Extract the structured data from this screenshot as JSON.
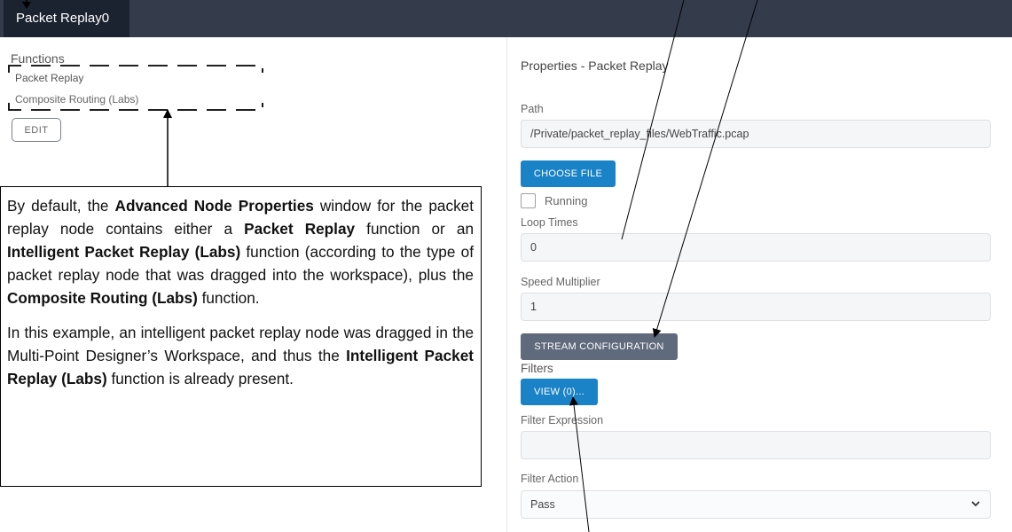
{
  "tab": {
    "label": "Packet Replay0"
  },
  "functions": {
    "title": "Functions",
    "items": [
      {
        "label": "Packet Replay"
      },
      {
        "label": "Composite Routing (Labs)"
      }
    ],
    "edit_label": "EDIT"
  },
  "callout": {
    "p1": [
      {
        "t": "By default, the ",
        "b": false
      },
      {
        "t": "Advanced Node Properties",
        "b": true
      },
      {
        "t": " window for the packet replay node contains either a ",
        "b": false
      },
      {
        "t": "Packet Replay",
        "b": true
      },
      {
        "t": " function or an ",
        "b": false
      },
      {
        "t": "Intelligent Packet Replay (Labs)",
        "b": true
      },
      {
        "t": " function (according to the type of packet replay node that was dragged into the workspace), plus the ",
        "b": false
      },
      {
        "t": "Composite Routing (Labs)",
        "b": true
      },
      {
        "t": " function.",
        "b": false
      }
    ],
    "p2": [
      {
        "t": "In this example, an intelligent packet replay node was dragged in the Multi-Point Designer’s Workspace, and thus the ",
        "b": false
      },
      {
        "t": "Intelligent Packet Replay (Labs)",
        "b": true
      },
      {
        "t": " function is already present.",
        "b": false
      }
    ]
  },
  "properties": {
    "title": "Properties  - Packet Replay",
    "path_label": "Path",
    "path_value": "/Private/packet_replay_files/WebTraffic.pcap",
    "choose_file_label": "CHOOSE FILE",
    "running_label": "Running",
    "loop_times_label": "Loop Times",
    "loop_times_value": "0",
    "speed_multiplier_label": "Speed Multiplier",
    "speed_multiplier_value": "1",
    "stream_config_label": "STREAM CONFIGURATION",
    "filters_label": "Filters",
    "view_label": "VIEW (0)...",
    "filter_expression_label": "Filter Expression",
    "filter_expression_value": "",
    "filter_action_label": "Filter Action",
    "filter_action_value": "Pass"
  }
}
